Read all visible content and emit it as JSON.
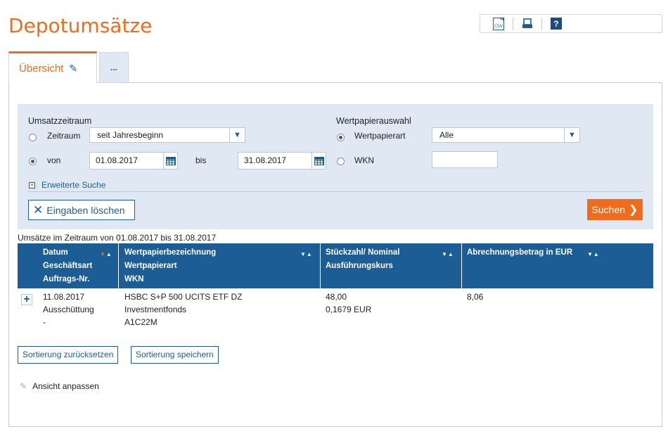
{
  "page_title": "Depotumsätze",
  "toolbar": {
    "csv_label": "CSV",
    "help_label": "?"
  },
  "tabs": [
    {
      "label": "Übersicht",
      "active": true
    },
    {
      "label": "..."
    }
  ],
  "filter": {
    "period_heading": "Umsatzzeitraum",
    "zeitraum_label": "Zeitraum",
    "zeitraum_value": "seit Jahresbeginn",
    "von_label": "von",
    "von_value": "01.08.2017",
    "bis_label": "bis",
    "bis_value": "31.08.2017",
    "security_heading": "Wertpapierauswahl",
    "wertpapierart_label": "Wertpapierart",
    "wertpapierart_value": "Alle",
    "wkn_label": "WKN",
    "wkn_value": "",
    "advanced_search": "Erweiterte Suche",
    "clear_label": "Eingaben löschen",
    "search_label": "Suchen"
  },
  "period_text": "Umsätze im Zeitraum von 01.08.2017 bis 31.08.2017",
  "table": {
    "columns": [
      {
        "lines": [
          "Datum",
          "Geschäftsart",
          "Auftrags-Nr."
        ]
      },
      {
        "lines": [
          "Wertpapierbezeichnung",
          "Wertpapierart",
          "WKN"
        ]
      },
      {
        "lines": [
          "Stückzahl/ Nominal",
          "Ausführungskurs"
        ]
      },
      {
        "lines": [
          "Abrechnungsbetrag in EUR"
        ]
      }
    ],
    "rows": [
      {
        "col1": [
          "11.08.2017",
          "Ausschüttung",
          "-"
        ],
        "col2": [
          "HSBC S+P 500 UCITS ETF DZ",
          "Investmentfonds",
          "A1C22M"
        ],
        "col3": [
          "48,00",
          "0,1679 EUR"
        ],
        "col4": [
          "8,06"
        ]
      }
    ]
  },
  "buttons": {
    "reset_sort": "Sortierung zurücksetzen",
    "save_sort": "Sortierung speichern"
  },
  "customize_view": "Ansicht anpassen",
  "colors": {
    "accent": "#f06c1c",
    "primary": "#1d5d96",
    "filter_bg": "#dfe8f3"
  }
}
